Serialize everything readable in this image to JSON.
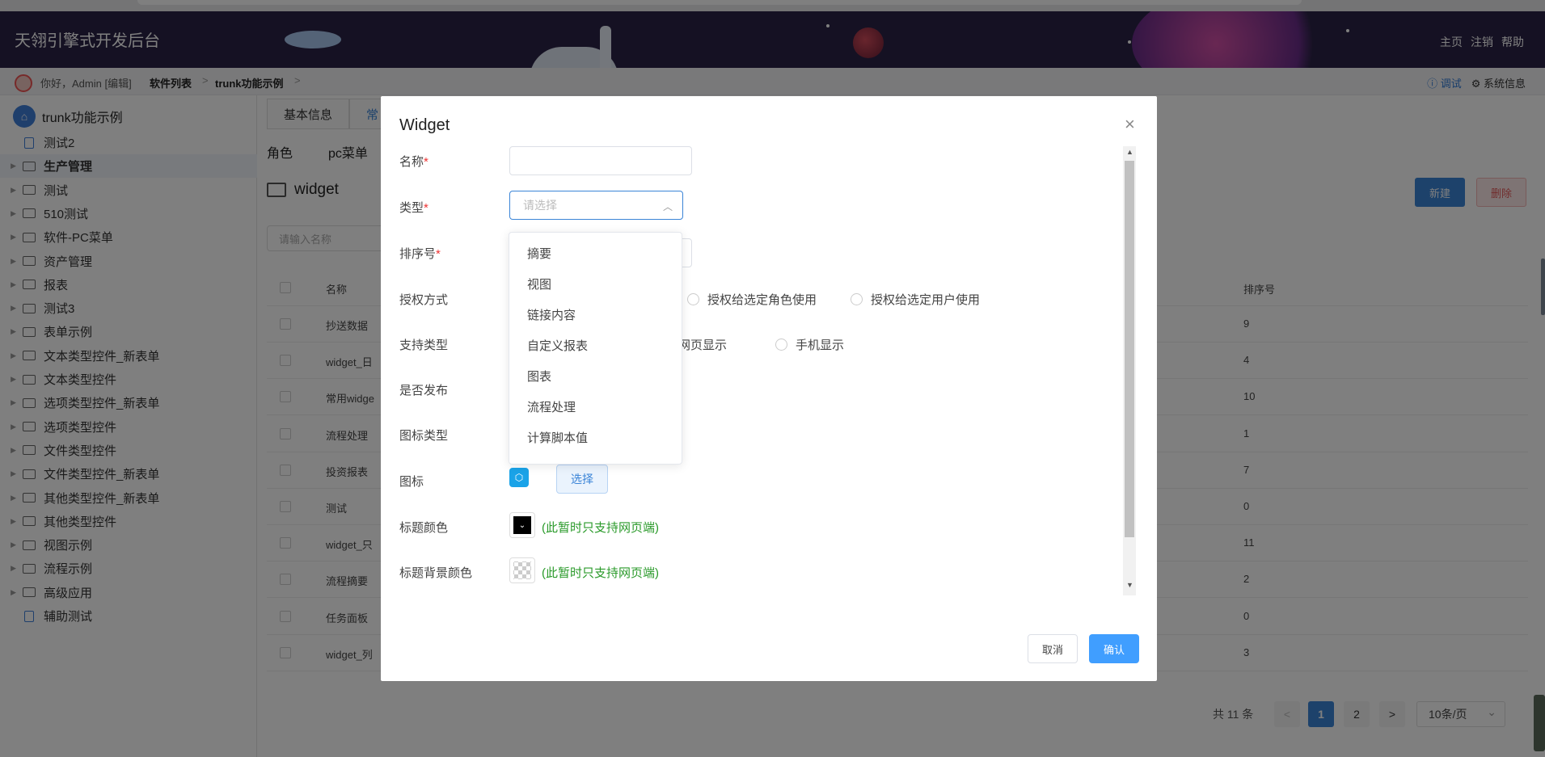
{
  "header": {
    "title": "天翎引擎式开发后台",
    "links": [
      "主页",
      "注销",
      "帮助"
    ]
  },
  "breadcrumb": {
    "greeting": "你好，Admin [编辑]",
    "items": [
      "软件列表",
      "trunk功能示例"
    ],
    "separator": ">",
    "right": {
      "debug": "调试",
      "system_info": "系统信息"
    }
  },
  "sidebar": {
    "root": "trunk功能示例",
    "items": [
      {
        "label": "测试2",
        "type": "doc"
      },
      {
        "label": "生产管理",
        "type": "folder",
        "active": true
      },
      {
        "label": "测试",
        "type": "folder"
      },
      {
        "label": "510测试",
        "type": "folder"
      },
      {
        "label": "软件-PC菜单",
        "type": "folder"
      },
      {
        "label": "资产管理",
        "type": "folder"
      },
      {
        "label": "报表",
        "type": "folder"
      },
      {
        "label": "测试3",
        "type": "folder"
      },
      {
        "label": "表单示例",
        "type": "folder"
      },
      {
        "label": "文本类型控件_新表单",
        "type": "folder"
      },
      {
        "label": "文本类型控件",
        "type": "folder"
      },
      {
        "label": "选项类型控件_新表单",
        "type": "folder"
      },
      {
        "label": "选项类型控件",
        "type": "folder"
      },
      {
        "label": "文件类型控件",
        "type": "folder"
      },
      {
        "label": "文件类型控件_新表单",
        "type": "folder"
      },
      {
        "label": "其他类型控件_新表单",
        "type": "folder"
      },
      {
        "label": "其他类型控件",
        "type": "folder"
      },
      {
        "label": "视图示例",
        "type": "folder"
      },
      {
        "label": "流程示例",
        "type": "folder"
      },
      {
        "label": "高级应用",
        "type": "folder"
      },
      {
        "label": "辅助测试",
        "type": "doc"
      }
    ]
  },
  "main": {
    "tabs": [
      "基本信息",
      "常"
    ],
    "subtabs": [
      "角色",
      "pc菜单"
    ],
    "folder_title": "widget",
    "new_button": "新建",
    "delete_button": "删除",
    "search_placeholder": "请输入名称",
    "columns": {
      "name": "名称",
      "order": "排序号"
    },
    "rows": [
      {
        "name": "抄送数据",
        "order": "9"
      },
      {
        "name": "widget_日",
        "order": "4"
      },
      {
        "name": "常用widge",
        "order": "10"
      },
      {
        "name": "流程处理",
        "order": "1"
      },
      {
        "name": "投资报表",
        "order": "7"
      },
      {
        "name": "测试",
        "order": "0"
      },
      {
        "name": "widget_只",
        "order": "11"
      },
      {
        "name": "流程摘要",
        "order": "2"
      },
      {
        "name": "任务面板",
        "order": "0"
      },
      {
        "name": "widget_列",
        "order": "3"
      }
    ]
  },
  "pager": {
    "total": "共 11 条",
    "prev": "<",
    "pages": [
      "1",
      "2"
    ],
    "current": "1",
    "next": ">",
    "page_size": "10条/页",
    "page_size_chevron": "⌄"
  },
  "dialog": {
    "title": "Widget",
    "close": "×",
    "required_mark": "*",
    "fields": {
      "name_label": "名称",
      "type_label": "类型",
      "type_placeholder": "请选择",
      "type_chevron": "︿",
      "order_label": "排序号",
      "auth_label": "授权方式",
      "auth_options": [
        "授权给选定角色使用",
        "授权给选定用户使用"
      ],
      "support_label": "支持类型",
      "support_options": [
        "网页显示",
        "手机显示"
      ],
      "publish_label": "是否发布",
      "icon_type_label": "图标类型",
      "icon_label": "图标",
      "icon_glyph": "⬡",
      "choose_button": "选择",
      "title_color_label": "标题颜色",
      "title_color_glyph": "⌄",
      "title_bg_label": "标题背景颜色",
      "web_only_note": "(此暂时只支持网页端)"
    },
    "cancel": "取消",
    "confirm": "确认"
  },
  "dropdown": {
    "options": [
      "摘要",
      "视图",
      "链接内容",
      "自定义报表",
      "图表",
      "流程处理",
      "计算脚本值"
    ]
  },
  "colors": {
    "header_bg": "#2b2346",
    "primary": "#409eff",
    "note_green": "#2a9a2a"
  }
}
